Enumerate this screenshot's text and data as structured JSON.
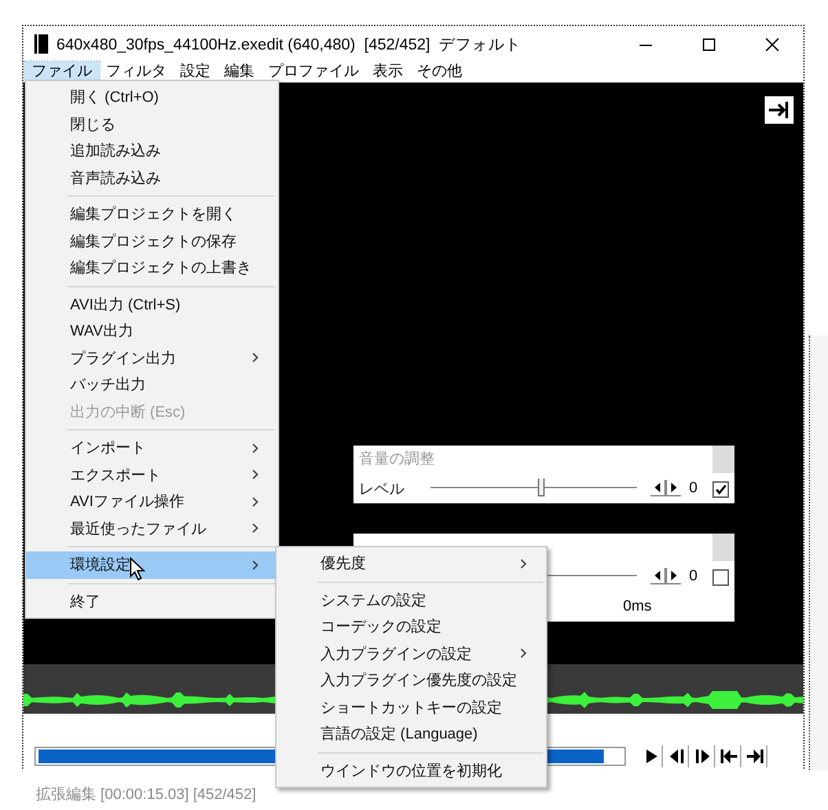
{
  "window": {
    "title": "640x480_30fps_44100Hz.exedit (640,480)  [452/452]  デフォルト"
  },
  "menu_bar": [
    {
      "label": "ファイル",
      "selected": true
    },
    {
      "label": "フィルタ",
      "selected": false
    },
    {
      "label": "設定",
      "selected": false
    },
    {
      "label": "編集",
      "selected": false
    },
    {
      "label": "プロファイル",
      "selected": false
    },
    {
      "label": "表示",
      "selected": false
    },
    {
      "label": "その他",
      "selected": false
    }
  ],
  "file_menu": {
    "groups": [
      [
        {
          "label": "開く (Ctrl+O)",
          "disabled": false,
          "submenu": false,
          "selected": false
        },
        {
          "label": "閉じる",
          "disabled": false,
          "submenu": false,
          "selected": false
        },
        {
          "label": "追加読み込み",
          "disabled": false,
          "submenu": false,
          "selected": false
        },
        {
          "label": "音声読み込み",
          "disabled": false,
          "submenu": false,
          "selected": false
        }
      ],
      [
        {
          "label": "編集プロジェクトを開く",
          "disabled": false,
          "submenu": false,
          "selected": false
        },
        {
          "label": "編集プロジェクトの保存",
          "disabled": false,
          "submenu": false,
          "selected": false
        },
        {
          "label": "編集プロジェクトの上書き",
          "disabled": false,
          "submenu": false,
          "selected": false
        }
      ],
      [
        {
          "label": "AVI出力 (Ctrl+S)",
          "disabled": false,
          "submenu": false,
          "selected": false
        },
        {
          "label": "WAV出力",
          "disabled": false,
          "submenu": false,
          "selected": false
        },
        {
          "label": "プラグイン出力",
          "disabled": false,
          "submenu": true,
          "selected": false
        },
        {
          "label": "バッチ出力",
          "disabled": false,
          "submenu": false,
          "selected": false
        },
        {
          "label": "出力の中断 (Esc)",
          "disabled": true,
          "submenu": false,
          "selected": false
        }
      ],
      [
        {
          "label": "インポート",
          "disabled": false,
          "submenu": true,
          "selected": false
        },
        {
          "label": "エクスポート",
          "disabled": false,
          "submenu": true,
          "selected": false
        },
        {
          "label": "AVIファイル操作",
          "disabled": false,
          "submenu": true,
          "selected": false
        },
        {
          "label": "最近使ったファイル",
          "disabled": false,
          "submenu": true,
          "selected": false
        }
      ],
      [
        {
          "label": "環境設定",
          "disabled": false,
          "submenu": true,
          "selected": true
        }
      ],
      [
        {
          "label": "終了",
          "disabled": false,
          "submenu": false,
          "selected": false
        }
      ]
    ]
  },
  "settings_submenu": {
    "groups": [
      [
        {
          "label": "優先度",
          "disabled": false,
          "submenu": true,
          "selected": false
        }
      ],
      [
        {
          "label": "システムの設定",
          "disabled": false,
          "submenu": false,
          "selected": false
        },
        {
          "label": "コーデックの設定",
          "disabled": false,
          "submenu": false,
          "selected": false
        },
        {
          "label": "入力プラグインの設定",
          "disabled": false,
          "submenu": true,
          "selected": false
        },
        {
          "label": "入力プラグイン優先度の設定",
          "disabled": false,
          "submenu": false,
          "selected": false
        },
        {
          "label": "ショートカットキーの設定",
          "disabled": false,
          "submenu": false,
          "selected": false
        },
        {
          "label": "言語の設定 (Language)",
          "disabled": false,
          "submenu": false,
          "selected": false
        }
      ],
      [
        {
          "label": "ウインドウの位置を初期化",
          "disabled": false,
          "submenu": false,
          "selected": false
        }
      ]
    ]
  },
  "panels": [
    {
      "title": "音量の調整",
      "checked": true,
      "rows": [
        {
          "label": "レベル",
          "level": 0.53,
          "value": "0"
        }
      ]
    },
    {
      "checked": false,
      "rows": [
        {
          "value": "0"
        }
      ],
      "footer": "0ms"
    }
  ],
  "transport": {
    "level": 0.97
  },
  "status_bar": "拡張編集 [00:00:15.03] [452/452]"
}
